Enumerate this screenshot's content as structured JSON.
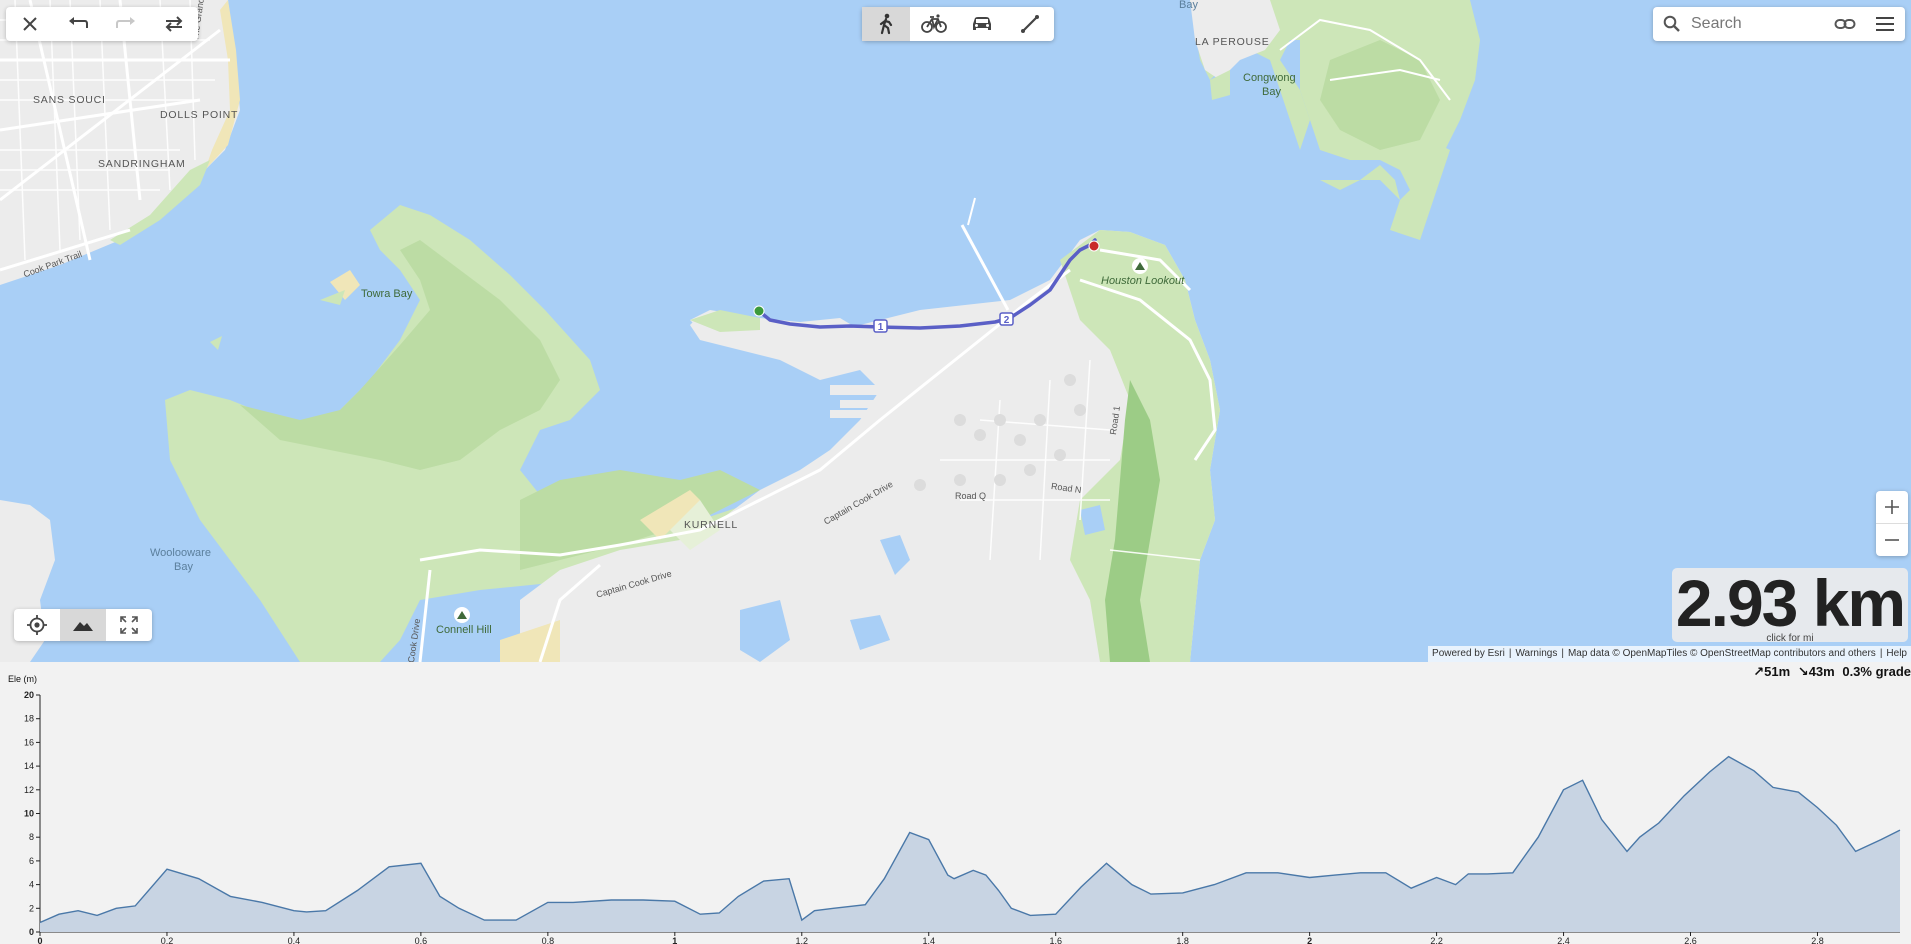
{
  "toolbar": {
    "close_icon": "close-icon",
    "undo_icon": "undo-icon",
    "redo_icon": "redo-icon",
    "reverse_icon": "reverse-route-icon"
  },
  "travel_modes": [
    {
      "name": "walk",
      "icon": "walking-icon",
      "active": true
    },
    {
      "name": "bike",
      "icon": "bicycle-icon",
      "active": false
    },
    {
      "name": "car",
      "icon": "car-icon",
      "active": false
    },
    {
      "name": "straight-line",
      "icon": "straight-line-icon",
      "active": false
    }
  ],
  "search": {
    "placeholder": "Search",
    "search_icon": "search-icon",
    "link_icon": "link-icon",
    "menu_icon": "menu-icon"
  },
  "zoom": {
    "in_icon": "plus-icon",
    "out_icon": "minus-icon"
  },
  "bottom_tools": {
    "locate_icon": "locate-icon",
    "terrain_icon": "terrain-icon",
    "fullscreen_icon": "fullscreen-icon"
  },
  "distance": {
    "value": "2.93 km",
    "hint": "click for mi"
  },
  "attribution": {
    "powered": "Powered by Esri",
    "warnings": "Warnings",
    "map_data": "Map data © OpenMapTiles © OpenStreetMap contributors and others",
    "help": "Help"
  },
  "map_labels": {
    "sans_souci": "SANS SOUCI",
    "dolls_point": "DOLLS POINT",
    "sandringham": "SANDRINGHAM",
    "grand_parade": "The Grand Parade",
    "cook_park_trail": "Cook Park Trail",
    "towra_bay": "Towra Bay",
    "woolooware_bay_1": "Woolooware",
    "woolooware_bay_2": "Bay",
    "kurnell": "KURNELL",
    "captain_cook_drive_1": "Captain Cook Drive",
    "captain_cook_drive_2": "Captain Cook Drive",
    "cook_drive": "Cook Drive",
    "connell_hill": "Connell Hill",
    "houston_lookout": "Houston Lookout",
    "road_q": "Road Q",
    "road_n": "Road N",
    "road_1": "Road 1",
    "la_perouse": "LA PEROUSE",
    "congwong_bay_1": "Congwong",
    "congwong_bay_2": "Bay",
    "bay_top": "Bay"
  },
  "route": {
    "markers": [
      "1",
      "2"
    ],
    "start_color": "#3c9a3c",
    "end_color": "#c92a2a",
    "line_color": "#5a5fc6"
  },
  "elevation_stats": {
    "gain": "51m",
    "loss": "43m",
    "grade": "0.3% grade"
  },
  "chart_data": {
    "type": "area",
    "title": "",
    "xlabel": "",
    "ylabel": "Ele (m)",
    "xlim": [
      0,
      2.93
    ],
    "ylim": [
      0,
      20
    ],
    "x_ticks": [
      "0",
      "0.2",
      "0.4",
      "0.6",
      "0.8",
      "1",
      "1.2",
      "1.4",
      "1.6",
      "1.8",
      "2",
      "2.2",
      "2.4",
      "2.6",
      "2.8"
    ],
    "y_ticks": [
      "0",
      "2",
      "4",
      "6",
      "8",
      "10",
      "12",
      "14",
      "16",
      "18",
      "20"
    ],
    "x": [
      0,
      0.03,
      0.06,
      0.09,
      0.12,
      0.15,
      0.2,
      0.25,
      0.3,
      0.35,
      0.4,
      0.42,
      0.45,
      0.5,
      0.55,
      0.6,
      0.63,
      0.66,
      0.7,
      0.73,
      0.75,
      0.8,
      0.84,
      0.9,
      0.95,
      1.0,
      1.04,
      1.07,
      1.1,
      1.14,
      1.18,
      1.2,
      1.22,
      1.25,
      1.3,
      1.33,
      1.37,
      1.4,
      1.43,
      1.44,
      1.47,
      1.49,
      1.51,
      1.53,
      1.56,
      1.6,
      1.64,
      1.68,
      1.72,
      1.75,
      1.8,
      1.85,
      1.9,
      1.95,
      2.0,
      2.04,
      2.08,
      2.12,
      2.16,
      2.2,
      2.23,
      2.25,
      2.28,
      2.32,
      2.36,
      2.4,
      2.43,
      2.46,
      2.5,
      2.52,
      2.55,
      2.59,
      2.63,
      2.66,
      2.7,
      2.73,
      2.77,
      2.8,
      2.83,
      2.86,
      2.9,
      2.93
    ],
    "series": [
      {
        "values": [
          0.8,
          1.5,
          1.8,
          1.4,
          2.0,
          2.2,
          5.3,
          4.5,
          3.0,
          2.5,
          1.8,
          1.7,
          1.8,
          3.5,
          5.5,
          5.8,
          3.0,
          2.0,
          1.0,
          1.0,
          1.0,
          2.5,
          2.5,
          2.7,
          2.7,
          2.6,
          1.5,
          1.6,
          3.0,
          4.3,
          4.5,
          1.0,
          1.8,
          2.0,
          2.3,
          4.5,
          8.4,
          7.8,
          4.8,
          4.5,
          5.2,
          4.8,
          3.5,
          2.0,
          1.4,
          1.5,
          3.8,
          5.8,
          4.0,
          3.2,
          3.3,
          4.0,
          5.0,
          5.0,
          4.6,
          4.8,
          5.0,
          5.0,
          3.7,
          4.6,
          4.0,
          4.9,
          4.9,
          5.0,
          8.0,
          12.0,
          12.8,
          9.5,
          6.8,
          8.0,
          9.2,
          11.5,
          13.5,
          14.8,
          13.6,
          12.2,
          11.8,
          10.5,
          9.0,
          6.8,
          7.8,
          8.6
        ]
      }
    ]
  }
}
